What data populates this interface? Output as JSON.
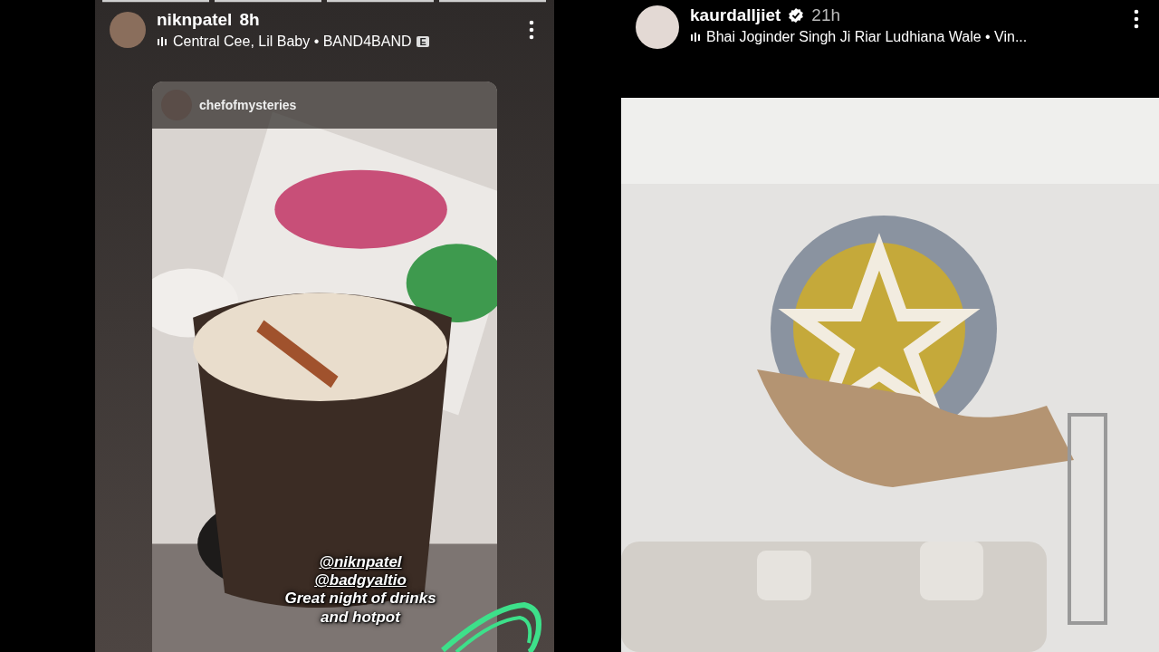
{
  "stories": [
    {
      "kind": "reshare",
      "user": "niknpatel",
      "time": "8h",
      "verified": false,
      "music": "Central Cee, Lil Baby • BAND4BAND",
      "explicit": "E",
      "shared_from": "chefofmysteries",
      "mentions": [
        "@niknpatel",
        "@badgyaltio"
      ],
      "caption": "Great night of drinks and hotpot"
    },
    {
      "kind": "photo",
      "user": "kaurdalljiet",
      "time": "21h",
      "verified": true,
      "music": "Bhai Joginder Singh Ji Riar Ludhiana Wale • Vin..."
    }
  ]
}
